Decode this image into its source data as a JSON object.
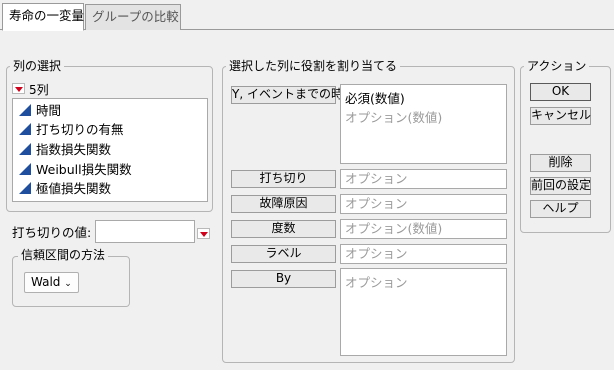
{
  "tabs": [
    "寿命の一変量",
    "グループの比較"
  ],
  "column_select": {
    "title": "列の選択",
    "count": "5列",
    "columns": [
      "時間",
      "打ち切りの有無",
      "指数損失関数",
      "Weibull損失関数",
      "極値損失関数"
    ]
  },
  "censor": {
    "label": "打ち切りの値:",
    "value": ""
  },
  "ci_method": {
    "title": "信頼区間の方法",
    "value": "Wald"
  },
  "roles": {
    "title": "選択した列に役割を割り当てる",
    "items": [
      {
        "button": "Y, イベントまでの時間",
        "lines": [
          "必須(数値)",
          "オプション(数値)"
        ]
      },
      {
        "button": "打ち切り",
        "lines": [
          "オプション"
        ]
      },
      {
        "button": "故障原因",
        "lines": [
          "オプション"
        ]
      },
      {
        "button": "度数",
        "lines": [
          "オプション(数値)"
        ]
      },
      {
        "button": "ラベル",
        "lines": [
          "オプション"
        ]
      },
      {
        "button": "By",
        "lines": [
          "オプション"
        ]
      }
    ]
  },
  "actions": {
    "title": "アクション",
    "buttons": [
      "OK",
      "キャンセル",
      "削除",
      "前回の設定",
      "ヘルプ"
    ]
  },
  "colors": {
    "icon_blue": "#1f4e9e",
    "accent_red": "#d0021b"
  }
}
